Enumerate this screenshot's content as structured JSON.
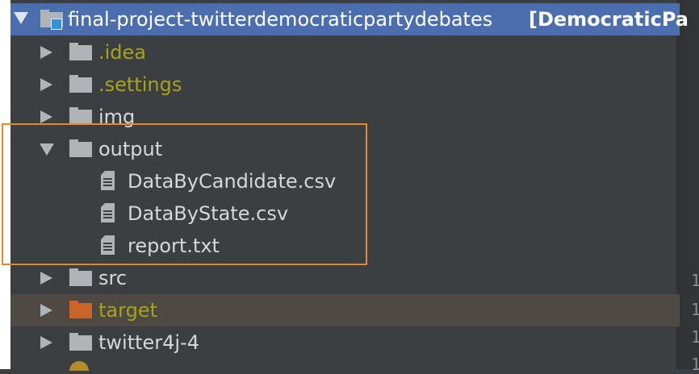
{
  "project_tree": {
    "root": {
      "name": "final-project-twitterdemocraticpartydebates",
      "module_label": "[DemocraticPa"
    },
    "items": [
      {
        "label": ".idea"
      },
      {
        "label": ".settings"
      },
      {
        "label": "img"
      },
      {
        "label": "output"
      },
      {
        "label": "DataByCandidate.csv"
      },
      {
        "label": "DataByState.csv"
      },
      {
        "label": "report.txt"
      },
      {
        "label": "src"
      },
      {
        "label": "target"
      },
      {
        "label": "twitter4j-4"
      }
    ]
  },
  "gutter_numbers": [
    "1",
    "1",
    "1",
    "1"
  ],
  "colors": {
    "panel_bg": "#3c3f41",
    "selection_bg": "#4b6eaf",
    "excluded_text": "#a5a31a",
    "target_row_bg": "#4e4a43",
    "highlight_box": "#e58a1f"
  }
}
